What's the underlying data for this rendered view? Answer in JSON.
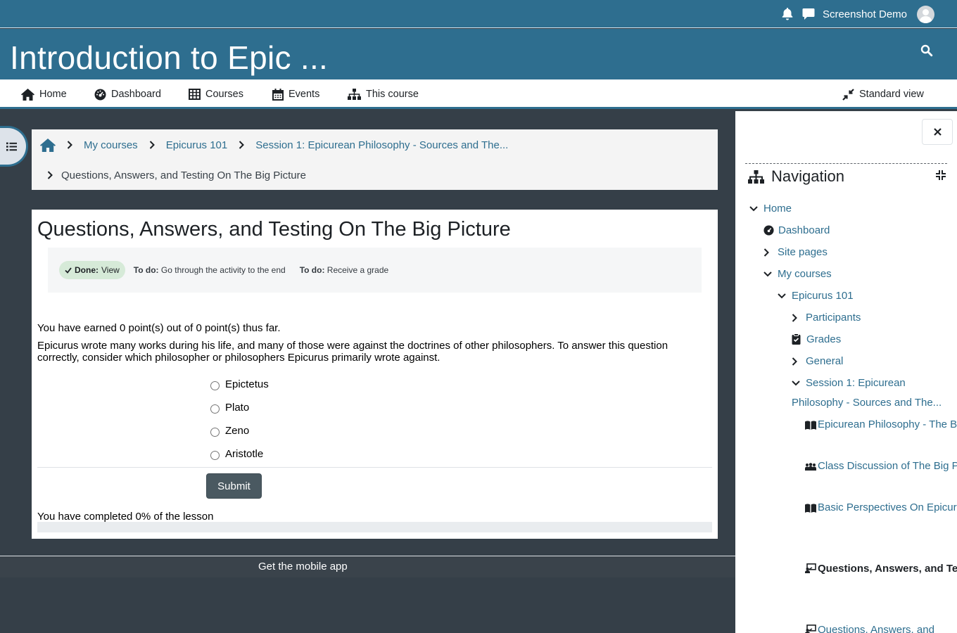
{
  "topbar": {
    "user_name": "Screenshot Demo",
    "bell_icon": "bell-icon",
    "chat_icon": "chat-icon"
  },
  "header": {
    "course_title": "Introduction to Epic ..."
  },
  "primary_nav": {
    "home": "Home",
    "dashboard": "Dashboard",
    "courses": "Courses",
    "events": "Events",
    "this_course": "This course",
    "standard_view": "Standard view"
  },
  "breadcrumb": {
    "items": [
      "My courses",
      "Epicurus 101",
      "Session 1: Epicurean Philosophy - Sources and The...",
      "Questions, Answers, and Testing On The Big Picture"
    ]
  },
  "lesson": {
    "title": "Questions, Answers, and Testing On The Big Picture",
    "completion": {
      "done_label": "Done:",
      "done_value": "View",
      "todo1_label": "To do:",
      "todo1_value": "Go through the activity to the end",
      "todo2_label": "To do:",
      "todo2_value": "Receive a grade"
    },
    "points_text": "You have earned 0 point(s) out of 0 point(s) thus far.",
    "question": "Epicurus wrote many works during his life, and many of those were against the doctrines of other philosophers. To answer this question correctly, consider which philosopher or philosophers Epicurus primarily wrote against.",
    "options": [
      "Epictetus",
      "Plato",
      "Zeno",
      "Aristotle"
    ],
    "submit_label": "Submit",
    "progress_text": "You have completed 0% of the lesson",
    "progress_percent": 0
  },
  "footer": {
    "mobile_app": "Get the mobile app"
  },
  "drawer": {
    "title": "Navigation",
    "tree": {
      "home": "Home",
      "dashboard": "Dashboard",
      "site_pages": "Site pages",
      "my_courses": "My courses",
      "course": "Epicurus 101",
      "participants": "Participants",
      "grades": "Grades",
      "general": "General",
      "session": "Session 1: Epicurean Philosophy - Sources and The...",
      "act1": "Epicurean Philosophy - The Big Picture",
      "act2": "Class Discussion of The Big Picture",
      "act3": "Basic Perspectives On Epicurus and the Epicurean S...",
      "act4": "Questions, Answers, and Testing On The Big Picture",
      "act5": "Questions, Answers, and"
    }
  },
  "colors": {
    "brand": "#2e6e8f",
    "page_bg": "#353f48",
    "button": "#4a5961",
    "done_badge": "#d6ead8"
  }
}
